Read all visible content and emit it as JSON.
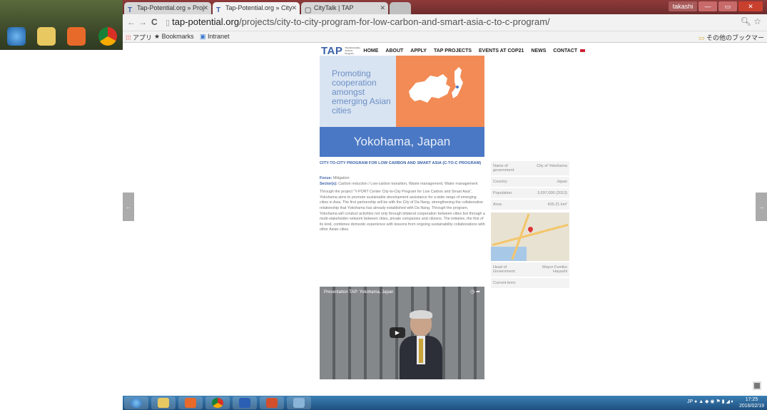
{
  "browser": {
    "tabs": [
      {
        "label": "Tap-Potential.org » Proj",
        "active": false
      },
      {
        "label": "Tap-Potential.org » City",
        "active": true
      },
      {
        "label": "CityTalk | TAP",
        "active": false
      }
    ],
    "url_domain": "tap-potential.org",
    "url_path": "/projects/city-to-city-program-for-low-carbon-and-smart-asia-c-to-c-program/",
    "user_label": "takashi",
    "bookmarks": {
      "apps": "アプリ",
      "bookmarks": "Bookmarks",
      "intranet": "Intranet",
      "other": "その他のブックマー"
    }
  },
  "site": {
    "logo": "TAP",
    "logo_sub": "Transformative Actions Program",
    "nav": [
      "HOME",
      "ABOUT",
      "APPLY",
      "TAP PROJECTS",
      "EVENTS AT COP21",
      "NEWS",
      "CONTACT"
    ],
    "hero": {
      "tagline": "Promoting cooperation amongst emerging Asian cities",
      "city": "Yokohama, Japan"
    },
    "article": {
      "title": "CITY-TO-CITY PROGRAM FOR LOW CARBON AND SMART ASIA (C-TO-C PROGRAM)",
      "focus_label": "Focus:",
      "focus_value": "Mitigation",
      "sectors_label": "Sector(s):",
      "sectors_value": "Carbon reduction / Low-carbon transition, Waste management, Water management",
      "body": "Through the project \"Y-PORT Center City-to-City Program for Low Carbon and Smart Asia\", Yokohama aims to promote sustainable development assistance for a wide range of emerging cities in Asia. The first partnership will be with the City of Da Nang, strengthening the collaborative relationship that Yokohama has already established with Da Nang. Through the program, Yokohama will conduct activities not only through bilateral cooperation between cities but through a multi-stakeholder network between cities, private companies and citizens. The initiative, the first of its kind, combines domestic experience with lessons from ongoing sustainability collaborations with other Asian cities."
    },
    "video": {
      "title": "Presentation TAP: Yokohama, Japan"
    },
    "info": {
      "rows_top": [
        {
          "k": "Name of government:",
          "v": "City of Yokohama"
        },
        {
          "k": "Country:",
          "v": "Japan"
        },
        {
          "k": "Population:",
          "v": "3,697,000 (2013)"
        },
        {
          "k": "Area:",
          "v": "435.21 km²"
        }
      ],
      "rows_bottom": [
        {
          "k": "Head of Government:",
          "v": "Mayor Fumiko Hayashi"
        },
        {
          "k": "Current term:",
          "v": ""
        }
      ]
    }
  },
  "taskbar": {
    "ime": "JP",
    "time": "17:25",
    "date": "2016/02/19"
  }
}
